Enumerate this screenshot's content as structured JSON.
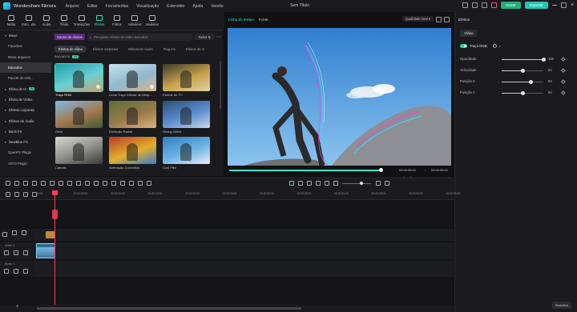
{
  "titlebar": {
    "app_name": "Wondershare Filmora",
    "menu": [
      "Arquivo",
      "Editar",
      "Ferramentas",
      "Visualização",
      "Extendido",
      "Ajuda",
      "Versão"
    ],
    "doc_title": "Sem Título",
    "save_label": "Salvar",
    "export_label": "Exportar"
  },
  "tools": [
    {
      "label": "Mídia",
      "icon": "media-icon"
    },
    {
      "label": "Esto...dio",
      "icon": "stock-icon"
    },
    {
      "label": "Áudio",
      "icon": "audio-icon"
    },
    {
      "label": "Título",
      "icon": "title-icon"
    },
    {
      "label": "Transições",
      "icon": "transitions-icon"
    },
    {
      "label": "Efeitos",
      "icon": "effects-icon",
      "active": true
    },
    {
      "label": "Filtros",
      "icon": "filters-icon"
    },
    {
      "label": "Adesivos",
      "icon": "stickers-icon"
    },
    {
      "label": "Modelos",
      "icon": "templates-icon"
    }
  ],
  "categories": [
    {
      "label": "Meus",
      "type": "section"
    },
    {
      "label": "Favoritos"
    },
    {
      "label": "Meus arquivos"
    },
    {
      "label": "Baixados",
      "selected": true
    },
    {
      "label": "Pacote de vísit..."
    },
    {
      "label": "Efeito de IA",
      "type": "section",
      "badge": "AI"
    },
    {
      "label": "Efeito de Vídeo",
      "type": "section"
    },
    {
      "label": "Efeitos corporais",
      "type": "section"
    },
    {
      "label": "Efeitos de Áudio",
      "type": "section"
    },
    {
      "label": "Boris FX",
      "type": "section"
    },
    {
      "label": "NewBlue FX",
      "type": "section"
    },
    {
      "label": "OpenFX Plugin"
    },
    {
      "label": "VST3 Plugin"
    }
  ],
  "browser": {
    "center_tag": "Centro de efeitos",
    "search_placeholder": "Pesquisar efeitos de vídeo baixados",
    "filter_label": "Todos",
    "tabs": [
      "Efeitos de vídeo",
      "Efeitos corporais",
      "Efeitos de Áudio",
      "Plug-ins",
      "Efeitos de IA"
    ],
    "section_label": "BAIXADOS",
    "section_count": "14",
    "items": [
      "Traço RGB",
      "Linda Traço Inferior de Desp...",
      "Parede de TV",
      "Olive",
      "Distinção Radial",
      "Strong Glitch",
      "Canvas",
      "Aberração Cromática",
      "Cool Film"
    ]
  },
  "preview": {
    "tab_timeline": "Linha do tempo",
    "tab_source": "Fonte",
    "quality": "Qualidade total",
    "time_current": "00:00:05:01",
    "time_sep": "/",
    "time_total": "00:00:05:01",
    "progress_fraction": 1.0
  },
  "props": {
    "title": "Efeitos",
    "tab_video": "Vídeo",
    "effect_name": "Traço RGB",
    "params": [
      {
        "name": "Opacidade",
        "value": "100",
        "fraction": 1.0
      },
      {
        "name": "Velocidade",
        "value": "50",
        "fraction": 0.5
      },
      {
        "name": "Posição X",
        "value": "50",
        "fraction": 0.7
      },
      {
        "name": "Posição Y",
        "value": "50",
        "fraction": 0.5
      }
    ],
    "reset_label": "Redefinir"
  },
  "timeline": {
    "ruler": [
      "00:00",
      "00:00:05:00",
      "00:00:10:00",
      "00:00:15:00",
      "00:00:20:00",
      "00:00:25:00",
      "00:00:30:00",
      "00:00:35:00",
      "00:00:40:00",
      "00:00:45:00",
      "00:00:50:00",
      "00:00:55:00"
    ],
    "tracks": [
      {
        "label": "",
        "type": "fx"
      },
      {
        "label": "Vídeo 1",
        "type": "video"
      },
      {
        "label": "Áudio 1",
        "type": "audio"
      }
    ]
  },
  "colors": {
    "accent": "#2ee6c8",
    "save_green": "#21b07b",
    "playhead": "#ff3b5c",
    "badge": "#2bd1a6",
    "tag_purple": "#5b2c82"
  }
}
